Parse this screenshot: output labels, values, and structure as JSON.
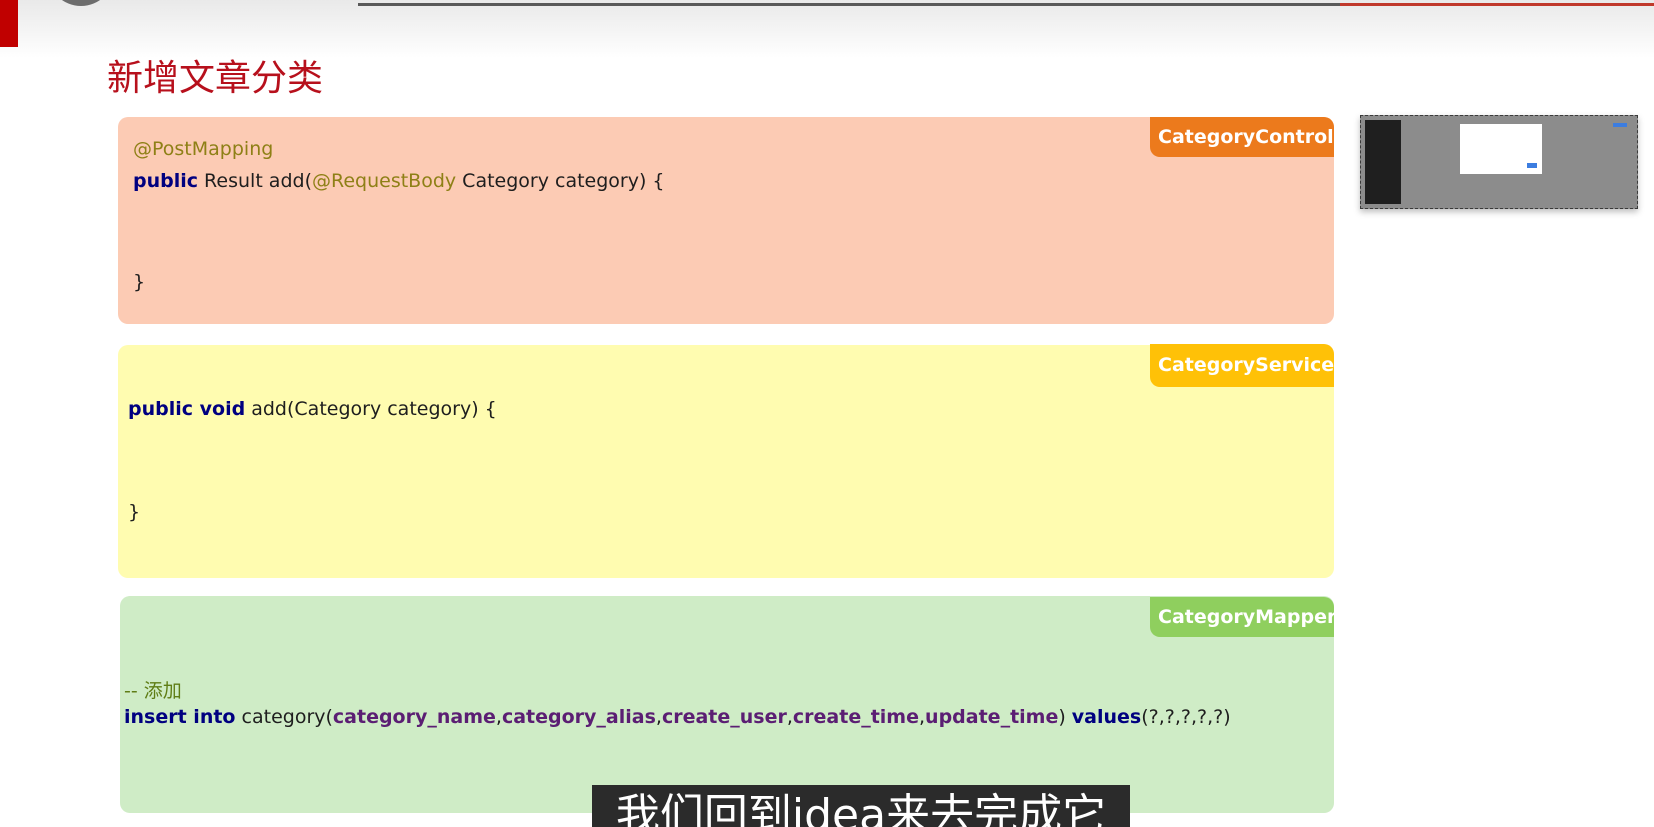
{
  "slide": {
    "title": "新增文章分类"
  },
  "panels": {
    "controller": {
      "tag": "CategoryController",
      "color": "#fccbb4",
      "tag_color": "#ec7a1c",
      "line1_annotation": "@PostMapping",
      "line2_kw": "public",
      "line2_text_a": " Result add(",
      "line2_annotation": "@RequestBody",
      "line2_text_b": " Category category) {",
      "close": "}"
    },
    "service": {
      "tag": "CategoryService",
      "color": "#fffcb0",
      "tag_color": "#ffc107",
      "line1_kw": "public void",
      "line1_text": " add(Category category) {",
      "close": "}"
    },
    "mapper": {
      "tag": "CategoryMapper",
      "color": "#cfecc6",
      "tag_color": "#8fcf5e",
      "comment": "-- 添加",
      "sql_kw1": "insert into",
      "sql_table": " category(",
      "sql_cols": [
        "category_name",
        "category_alias",
        "create_user",
        "create_time",
        "update_time"
      ],
      "sql_sep": ",",
      "sql_close": ") ",
      "sql_kw2": "values",
      "sql_values": "(?,?,?,?,?)"
    }
  },
  "subtitle": "我们回到idea来去完成它"
}
